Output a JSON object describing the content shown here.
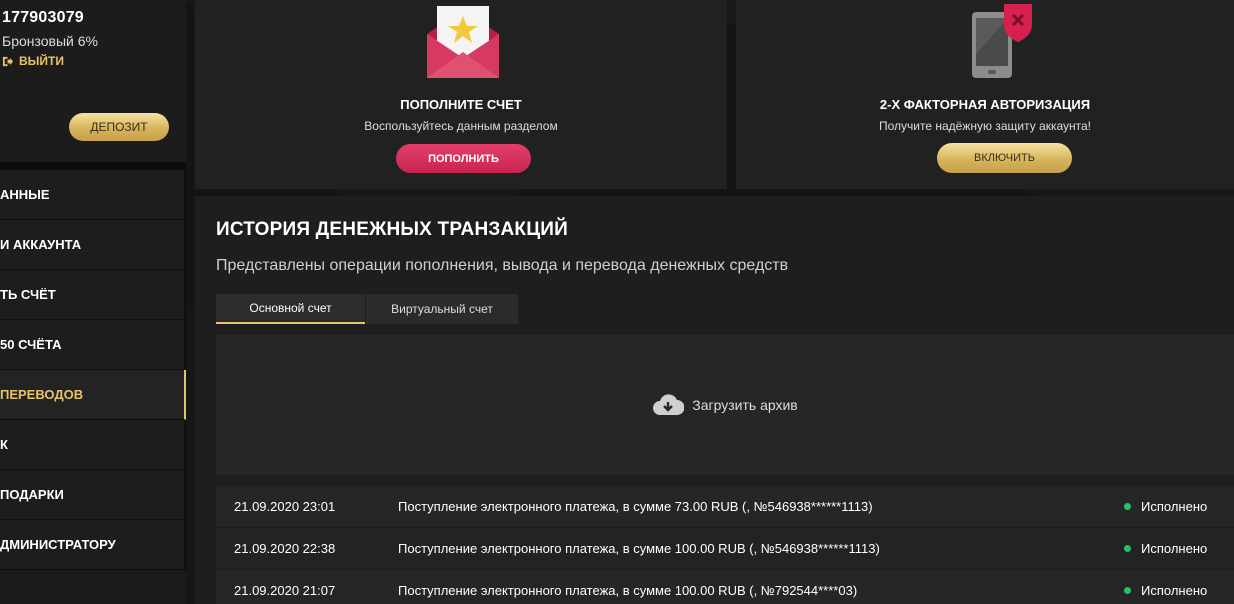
{
  "user": {
    "id": "177903079",
    "level": "Бронзовый 6%",
    "logout_label": "ВЫЙТИ",
    "deposit_label": "ДЕПОЗИТ"
  },
  "sidebar": {
    "items": [
      {
        "label": "АННЫЕ",
        "active": false
      },
      {
        "label": "И АККАУНТА",
        "active": false
      },
      {
        "label": "ТЬ СЧЁТ",
        "active": false
      },
      {
        "label": "50 СЧЁТА",
        "active": false
      },
      {
        "label": "ПЕРЕВОДОВ",
        "active": true
      },
      {
        "label": "К",
        "active": false
      },
      {
        "label": "ПОДАРКИ",
        "active": false
      },
      {
        "label": "ДМИНИСТРАТОРУ",
        "active": false
      }
    ]
  },
  "cards": {
    "topup": {
      "icon": "envelope-star-icon",
      "title": "ПОПОЛНИТЕ СЧЕТ",
      "subtitle": "Воспользуйтесь данным разделом",
      "button": "ПОПОЛНИТЬ"
    },
    "twofa": {
      "icon": "phone-shield-icon",
      "title": "2-Х ФАКТОРНАЯ АВТОРИЗАЦИЯ",
      "subtitle": "Получите надёжную защиту аккаунта!",
      "button": "ВКЛЮЧИТЬ"
    }
  },
  "history": {
    "title": "ИСТОРИЯ ДЕНЕЖНЫХ ТРАНЗАКЦИЙ",
    "subtitle": "Представлены операции пополнения, вывода и перевода денежных средств",
    "tabs": [
      {
        "label": "Основной счет",
        "active": true
      },
      {
        "label": "Виртуальный счет",
        "active": false
      }
    ],
    "archive_label": "Загрузить архив",
    "transactions": [
      {
        "date": "21.09.2020 23:01",
        "description": "Поступление электронного платежа, в сумме 73.00 RUB (, №546938******1113)",
        "status": "Исполнено"
      },
      {
        "date": "21.09.2020 22:38",
        "description": "Поступление электронного платежа, в сумме 100.00 RUB (, №546938******1113)",
        "status": "Исполнено"
      },
      {
        "date": "21.09.2020 21:07",
        "description": "Поступление электронного платежа, в сумме 100.00 RUB (, №792544****03)",
        "status": "Исполнено"
      }
    ]
  },
  "colors": {
    "accent_gold": "#e7c46b",
    "accent_pink": "#c8244f",
    "status_green": "#1fc46a"
  }
}
